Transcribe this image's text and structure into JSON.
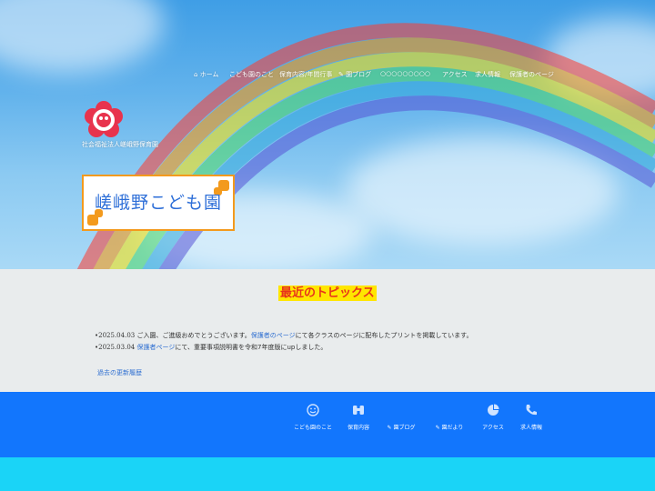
{
  "nav": {
    "items": [
      {
        "icon": "home-icon",
        "label": "ホーム"
      },
      {
        "label": "こども園のこと"
      },
      {
        "label": "保育内容/年間行事"
      },
      {
        "icon": "pen-icon",
        "label": "園ブログ"
      },
      {
        "label": "○○○○○○○○○"
      },
      {
        "label": "アクセス"
      },
      {
        "label": "求人情報"
      },
      {
        "label": "保護者のページ"
      }
    ]
  },
  "logo": {
    "caption": "社会福祉法人嵯峨野保育園",
    "colors": {
      "outer": "#e8334d",
      "inner": "#ffffff",
      "center": "#e8334d"
    }
  },
  "signboard": {
    "text": "嵯峨野こども園",
    "border_color": "#f39a1d",
    "text_color": "#2e6fd8"
  },
  "topics": {
    "title": "最近のトピックス",
    "news": [
      {
        "bullet": "•",
        "date": "2025.04.03",
        "pre": "ご入園、ご進級おめでとうございます。",
        "link": "保護者のページ",
        "post": "にて各クラスのページに配布したプリントを掲載しています。"
      },
      {
        "bullet": "•",
        "date": "2025.03.04",
        "pre": "",
        "link": "保護者ページ",
        "post": "にて、重要事項説明書を令和7年度版にupしました。"
      }
    ],
    "past_link": "過去の更新履歴"
  },
  "footer_nav": {
    "items": [
      {
        "icon": "smile-icon",
        "label": "こども園のこと"
      },
      {
        "icon": "binoculars-icon",
        "label": "保育内容"
      },
      {
        "icon": "pen-icon",
        "label": "園ブログ"
      },
      {
        "icon": "pen-icon",
        "label": "園だより"
      },
      {
        "icon": "pie-chart-icon",
        "label": "アクセス"
      },
      {
        "icon": "phone-icon",
        "label": "求人情報"
      }
    ]
  },
  "colors": {
    "topics_bg": "#e9eced",
    "footer_bg": "#1276fd",
    "strip_bg": "#1ad4f7",
    "link": "#2f6fd1",
    "title_bg": "#ffe600",
    "title_fg": "#e8331b"
  }
}
